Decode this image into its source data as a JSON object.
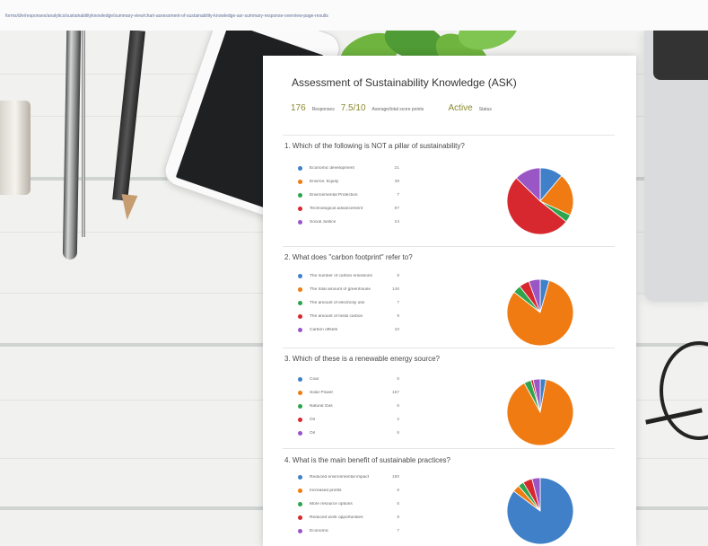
{
  "browser": {
    "url": "forms/d/e/responses/analytics/sustainabilityknowledge/summary-view/chart-assessment-of-sustainability-knowledge-asr-summary-response-overview-page-results"
  },
  "form": {
    "title": "Assessment of Sustainability Knowledge (ASK)",
    "stats": [
      {
        "value": "176",
        "label": "Responses"
      },
      {
        "value": "7.5/10",
        "label": "Average/total score points"
      },
      {
        "value": "Active",
        "label": "Status"
      }
    ]
  },
  "colors": {
    "blue": "#3f80c8",
    "orange": "#ef7b12",
    "green": "#2ea54c",
    "red": "#d7282f",
    "purple": "#9b56c6"
  },
  "questions": [
    {
      "number": "1.",
      "title": "Which of the following is NOT a pillar of sustainability?",
      "options": [
        {
          "label": "Economic development",
          "count": "21",
          "value": 21,
          "color": "#3f80c8"
        },
        {
          "label": "Environ. Equity",
          "count": "39",
          "value": 39,
          "color": "#ef7b12"
        },
        {
          "label": "Environmental Protection",
          "count": "7",
          "value": 7,
          "color": "#2ea54c"
        },
        {
          "label": "Technological advancement",
          "count": "97",
          "value": 97,
          "color": "#d7282f"
        },
        {
          "label": "Social Justice",
          "count": "24",
          "value": 24,
          "color": "#9b56c6"
        }
      ]
    },
    {
      "number": "2.",
      "title": "What does \"carbon footprint\" refer to?",
      "options": [
        {
          "label": "The number of carbon emissions",
          "count": "8",
          "value": 8,
          "color": "#3f80c8"
        },
        {
          "label": "The total amount of greenhouse",
          "count": "146",
          "value": 146,
          "color": "#ef7b12"
        },
        {
          "label": "The amount of electricity use",
          "count": "7",
          "value": 7,
          "color": "#2ea54c"
        },
        {
          "label": "The amount of fossil carbon",
          "count": "9",
          "value": 9,
          "color": "#d7282f"
        },
        {
          "label": "Carbon offsets",
          "count": "10",
          "value": 10,
          "color": "#9b56c6"
        }
      ]
    },
    {
      "number": "3.",
      "title": "Which of these is a renewable energy source?",
      "options": [
        {
          "label": "Coal",
          "count": "5",
          "value": 5,
          "color": "#3f80c8"
        },
        {
          "label": "Solar Power",
          "count": "157",
          "value": 157,
          "color": "#ef7b12"
        },
        {
          "label": "Natural Gas",
          "count": "6",
          "value": 6,
          "color": "#2ea54c"
        },
        {
          "label": "Oil",
          "count": "2",
          "value": 2,
          "color": "#d7282f"
        },
        {
          "label": "Oil",
          "count": "6",
          "value": 6,
          "color": "#9b56c6"
        }
      ]
    },
    {
      "number": "4.",
      "title": "What is the main benefit of sustainable practices?",
      "options": [
        {
          "label": "Reduced environmental impact",
          "count": "150",
          "value": 150,
          "color": "#3f80c8"
        },
        {
          "label": "Increased profits",
          "count": "6",
          "value": 6,
          "color": "#ef7b12"
        },
        {
          "label": "More resource options",
          "count": "5",
          "value": 5,
          "color": "#2ea54c"
        },
        {
          "label": "Reduced work opportunities",
          "count": "8",
          "value": 8,
          "color": "#d7282f"
        },
        {
          "label": "Economic",
          "count": "7",
          "value": 7,
          "color": "#9b56c6"
        }
      ]
    }
  ]
}
